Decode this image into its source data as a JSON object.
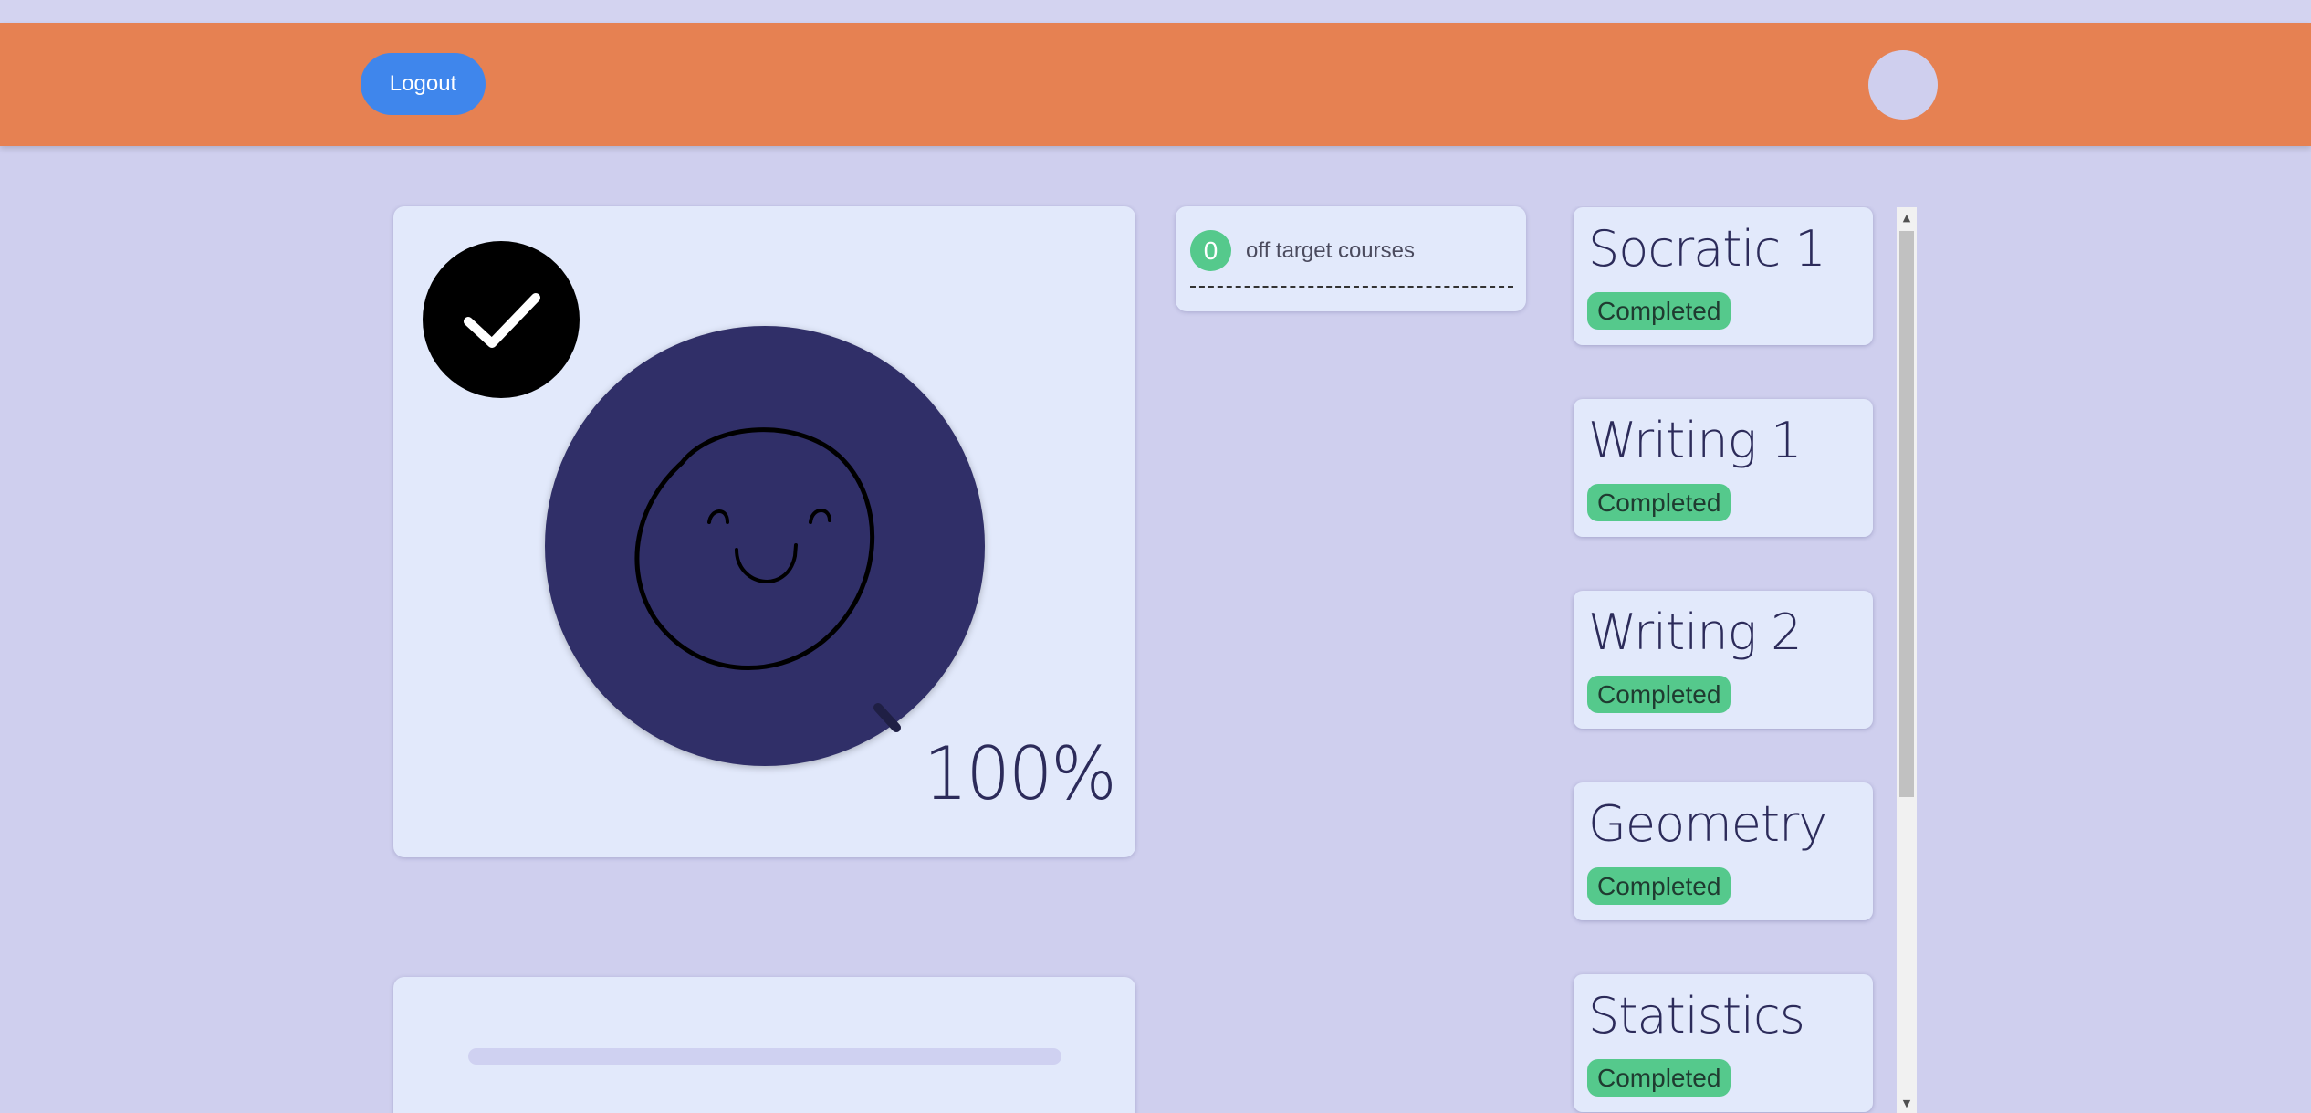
{
  "header": {
    "logout_label": "Logout"
  },
  "progress": {
    "percent_text": "100%",
    "completed_fraction": 1.0
  },
  "off_target": {
    "count": "0",
    "label": "off target courses"
  },
  "courses": [
    {
      "name": "Socratic 1",
      "status": "Completed"
    },
    {
      "name": "Writing 1",
      "status": "Completed"
    },
    {
      "name": "Writing 2",
      "status": "Completed"
    },
    {
      "name": "Geometry",
      "status": "Completed"
    },
    {
      "name": "Statistics",
      "status": "Completed"
    }
  ],
  "colors": {
    "header": "#e68152",
    "logout_button": "#3f86ec",
    "background": "#cfcfee",
    "card": "#e2e9fb",
    "smiley_circle": "#302f68",
    "status_green": "#55c98c"
  },
  "icons": {
    "check": "checkmark-icon",
    "smiley": "smiley-face-icon"
  }
}
